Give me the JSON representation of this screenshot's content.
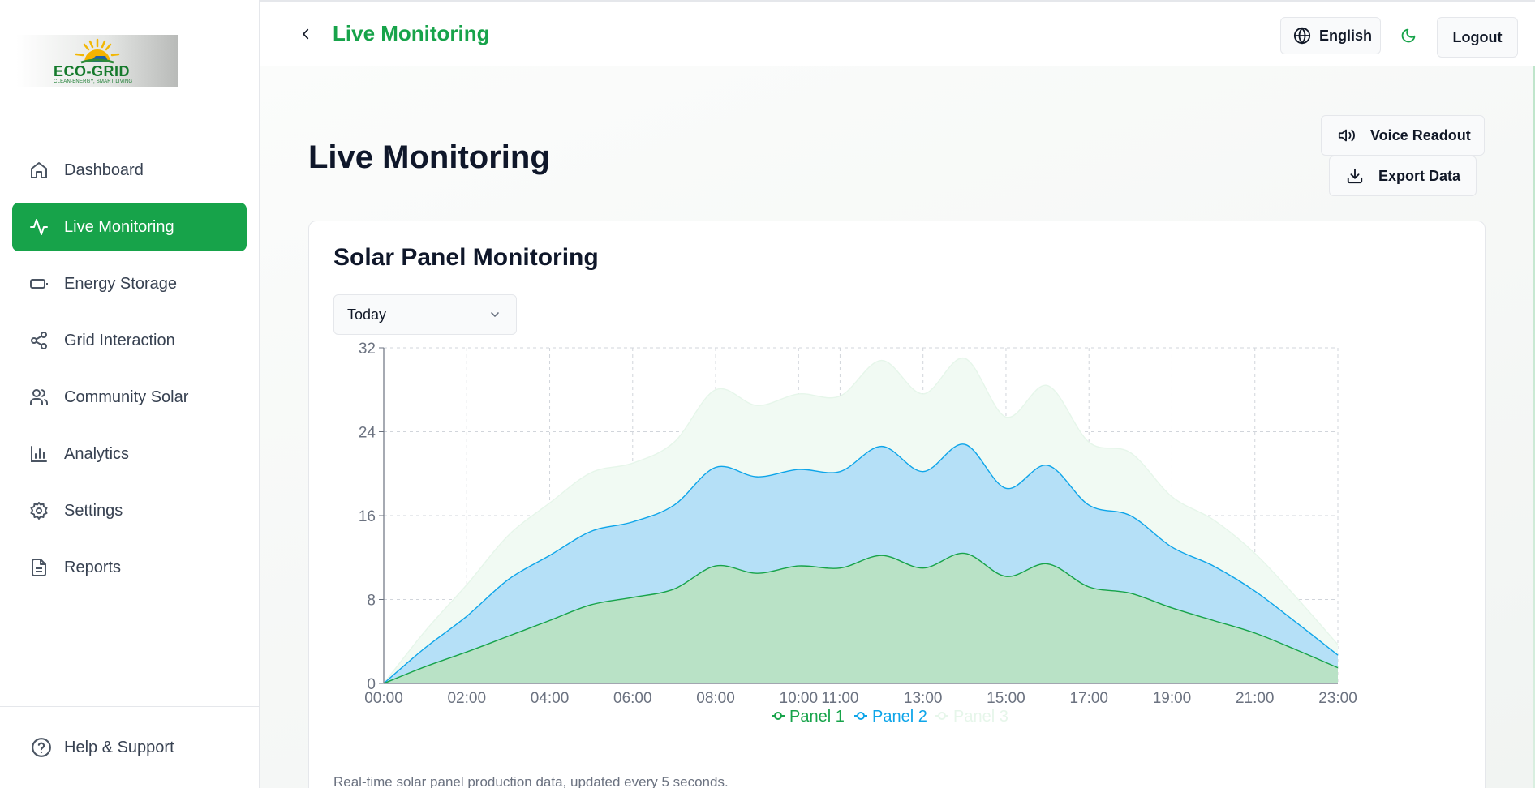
{
  "logo": {
    "name": "ECO-GRID",
    "tagline": "CLEAN-ENERGY, SMART LIVING"
  },
  "sidebar": {
    "items": [
      {
        "label": "Dashboard",
        "icon": "home-icon",
        "active": false
      },
      {
        "label": "Live Monitoring",
        "icon": "activity-icon",
        "active": true
      },
      {
        "label": "Energy Storage",
        "icon": "battery-icon",
        "active": false
      },
      {
        "label": "Grid Interaction",
        "icon": "share-icon",
        "active": false
      },
      {
        "label": "Community Solar",
        "icon": "users-icon",
        "active": false
      },
      {
        "label": "Analytics",
        "icon": "bar-chart-icon",
        "active": false
      },
      {
        "label": "Settings",
        "icon": "gear-icon",
        "active": false
      },
      {
        "label": "Reports",
        "icon": "file-text-icon",
        "active": false
      }
    ],
    "help_label": "Help & Support"
  },
  "topbar": {
    "title": "Live Monitoring",
    "language_label": "English",
    "logout_label": "Logout"
  },
  "page": {
    "title": "Live Monitoring",
    "voice_label": "Voice Readout",
    "export_label": "Export Data"
  },
  "card": {
    "title": "Solar Panel Monitoring",
    "range_selected": "Today",
    "caption": "Real-time solar panel production data, updated every 5 seconds."
  },
  "colors": {
    "accent": "#17a34a",
    "panel1": "#17a34a",
    "panel2": "#0ea5e9",
    "panel3": "#d1fae5"
  },
  "chart_data": {
    "type": "area",
    "stacked": true,
    "x": [
      "00:00",
      "01:00",
      "02:00",
      "03:00",
      "04:00",
      "05:00",
      "06:00",
      "07:00",
      "08:00",
      "09:00",
      "10:00",
      "11:00",
      "12:00",
      "13:00",
      "14:00",
      "15:00",
      "16:00",
      "17:00",
      "18:00",
      "19:00",
      "20:00",
      "21:00",
      "22:00",
      "23:00"
    ],
    "x_tick_labels": [
      "00:00",
      "02:00",
      "04:00",
      "06:00",
      "08:00",
      "10:00",
      "11:00",
      "13:00",
      "15:00",
      "17:00",
      "19:00",
      "21:00",
      "23:00"
    ],
    "ylim": [
      0,
      32
    ],
    "y_ticks": [
      0,
      8,
      16,
      24,
      32
    ],
    "grid": true,
    "legend": "bottom-center",
    "series": [
      {
        "name": "Panel 1",
        "values": [
          0,
          1.6,
          3.0,
          4.5,
          6.0,
          7.5,
          8.2,
          9.0,
          11.2,
          10.5,
          11.2,
          11.0,
          12.2,
          11.0,
          12.4,
          10.2,
          11.4,
          9.2,
          8.6,
          7.2,
          6.0,
          4.8,
          3.2,
          1.5
        ]
      },
      {
        "name": "Panel 2",
        "values": [
          0,
          1.8,
          3.4,
          5.4,
          6.2,
          7.0,
          7.2,
          8.0,
          9.4,
          9.2,
          9.2,
          9.2,
          10.4,
          9.2,
          10.4,
          8.4,
          9.4,
          7.8,
          7.4,
          5.8,
          5.2,
          4.0,
          2.6,
          1.2
        ]
      },
      {
        "name": "Panel 3",
        "values": [
          0,
          1.6,
          3.0,
          4.2,
          5.0,
          5.6,
          5.6,
          6.0,
          7.4,
          6.8,
          7.2,
          7.2,
          8.2,
          7.4,
          8.2,
          6.8,
          7.6,
          6.0,
          6.0,
          4.8,
          4.4,
          3.6,
          2.4,
          1.0
        ]
      }
    ]
  }
}
